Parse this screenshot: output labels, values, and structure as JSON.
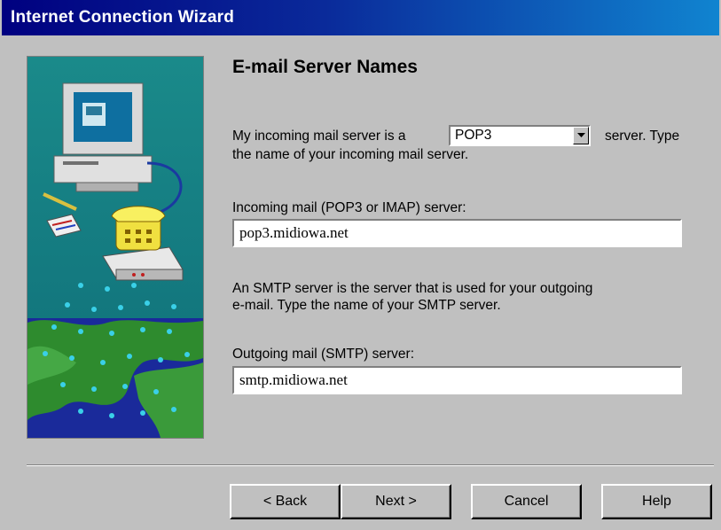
{
  "window": {
    "title": "Internet Connection Wizard"
  },
  "page": {
    "heading": "E-mail Server Names",
    "incoming_prefix": "My incoming mail server is a",
    "incoming_suffix": "server. Type",
    "incoming_line2": "the name of your incoming mail server.",
    "server_type": {
      "selected": "POP3"
    },
    "incoming_label": "Incoming mail (POP3 or IMAP) server:",
    "incoming_value": "pop3.midiowa.net",
    "smtp_desc_line1": "An SMTP server is the server that is used for your outgoing",
    "smtp_desc_line2": "e-mail.  Type the name of your SMTP server.",
    "outgoing_label": "Outgoing mail (SMTP) server:",
    "outgoing_value": "smtp.midiowa.net"
  },
  "buttons": {
    "back": "< Back",
    "next": "Next >",
    "cancel": "Cancel",
    "help": "Help"
  },
  "colors": {
    "titlebar_start": "#000080",
    "titlebar_end": "#1084d0",
    "face": "#c0c0c0"
  }
}
